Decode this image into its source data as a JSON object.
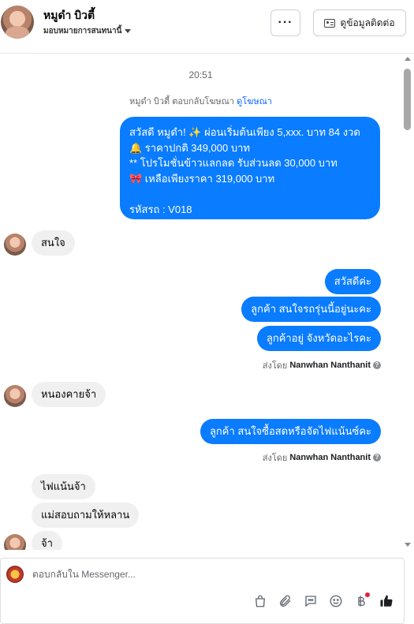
{
  "header": {
    "contact_name": "หมูดำ บิวตี้",
    "assign_label": "มอบหมายการสนทนานี้",
    "more_label": "···",
    "view_contact_label": "ดูข้อมูลติดต่อ"
  },
  "thread": {
    "timestamp": "20:51",
    "reply_note_prefix": "หมูดำ บิวตี้ ตอบกลับโฆษณา",
    "reply_note_link": "ดูโฆษณา",
    "ad_message": {
      "line1": "สวัสดี หมูดำ! ✨ ผ่อนเริ่มต้นเพียง 5,xxx. บาท 84 งวด",
      "line2": "🔔 ราคาปกติ 349,000 บาท",
      "line3": "** โปรโมชั่นข้าวแลกลด รับส่วนลด 30,000 บาท",
      "line4": "🎀 เหลือเพียงราคา 319,000 บาท",
      "line5": "",
      "line6": "รหัสรถ : V018"
    },
    "in_1": "สนใจ",
    "out_1": "สวัสดีค่ะ",
    "out_2": "ลูกค้า สนใจรถรุ่นนี้อยู่นะคะ",
    "out_3": "ลูกค้าอยู่ จังหวัดอะไรคะ",
    "sent_by_prefix": "ส่งโดย",
    "sent_by_name": "Nanwhan Nanthanit",
    "in_2": "หนองคายจ้า",
    "out_4": "ลูกค้า สนใจซื้อสดหรือจัดไฟแน้นซ์คะ",
    "in_3": "ไฟแน้นจ้า",
    "in_4": "แม่สอบถามให้หลาน",
    "in_5": "จ้า"
  },
  "composer": {
    "placeholder": "ตอบกลับใน Messenger...",
    "tools": [
      "shopping-bag-icon",
      "attachment-icon",
      "saved-reply-icon",
      "emoji-icon",
      "baht-payment-icon",
      "like-icon"
    ]
  },
  "colors": {
    "outgoing_bubble": "#0a7cff",
    "incoming_bubble": "#f0f0f0",
    "link": "#0866ff"
  }
}
